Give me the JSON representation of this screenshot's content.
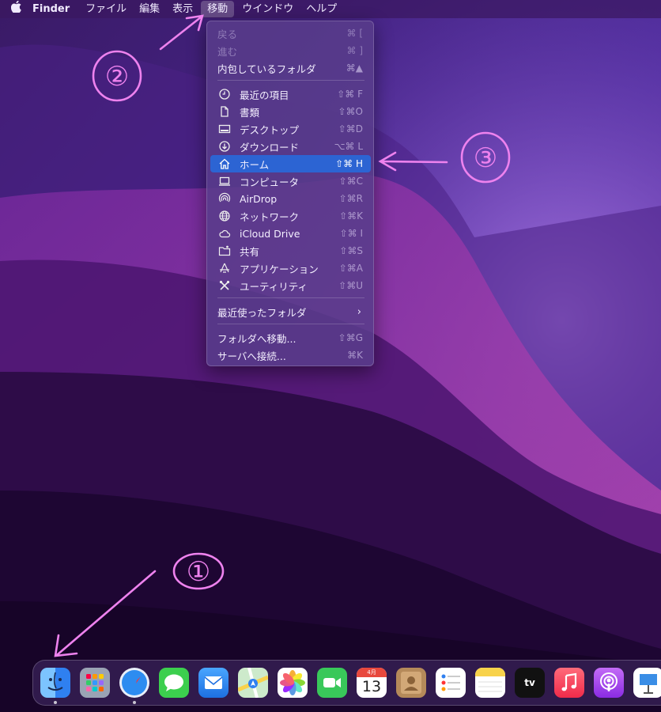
{
  "menubar": {
    "apple_icon": "apple-icon",
    "app_name": "Finder",
    "items": [
      "ファイル",
      "編集",
      "表示",
      "移動",
      "ウインドウ",
      "ヘルプ"
    ],
    "active_item": "移動"
  },
  "go_menu": {
    "top_items": [
      {
        "label": "戻る",
        "shortcut": "⌘ [",
        "enabled": false
      },
      {
        "label": "進む",
        "shortcut": "⌘ ]",
        "enabled": false
      },
      {
        "label": "内包しているフォルダ",
        "shortcut": "⌘▲",
        "enabled": true
      }
    ],
    "places": [
      {
        "label": "最近の項目",
        "shortcut": "⇧⌘ F",
        "icon": "clock-icon"
      },
      {
        "label": "書類",
        "shortcut": "⇧⌘O",
        "icon": "document-icon"
      },
      {
        "label": "デスクトップ",
        "shortcut": "⇧⌘D",
        "icon": "desktop-icon"
      },
      {
        "label": "ダウンロード",
        "shortcut": "⌥⌘ L",
        "icon": "download-icon"
      },
      {
        "label": "ホーム",
        "shortcut": "⇧⌘ H",
        "icon": "home-icon",
        "highlighted": true
      },
      {
        "label": "コンピュータ",
        "shortcut": "⇧⌘C",
        "icon": "laptop-icon"
      },
      {
        "label": "AirDrop",
        "shortcut": "⇧⌘R",
        "icon": "airdrop-icon"
      },
      {
        "label": "ネットワーク",
        "shortcut": "⇧⌘K",
        "icon": "network-globe-icon"
      },
      {
        "label": "iCloud Drive",
        "shortcut": "⇧⌘ I",
        "icon": "cloud-icon"
      },
      {
        "label": "共有",
        "shortcut": "⇧⌘S",
        "icon": "shared-folder-icon"
      },
      {
        "label": "アプリケーション",
        "shortcut": "⇧⌘A",
        "icon": "applications-icon"
      },
      {
        "label": "ユーティリティ",
        "shortcut": "⇧⌘U",
        "icon": "utilities-tools-icon"
      }
    ],
    "recent_folders": {
      "label": "最近使ったフォルダ",
      "icon": "chevron-right-icon"
    },
    "bottom_items": [
      {
        "label": "フォルダへ移動...",
        "shortcut": "⇧⌘G"
      },
      {
        "label": "サーバへ接続...",
        "shortcut": "⌘K"
      }
    ]
  },
  "annotations": {
    "color": "#ee82ee",
    "marks": [
      "①",
      "②",
      "③"
    ]
  },
  "dock": {
    "apps": [
      {
        "name": "finder-icon",
        "running": true
      },
      {
        "name": "launchpad-icon",
        "running": false
      },
      {
        "name": "safari-icon",
        "running": true
      },
      {
        "name": "messages-icon",
        "running": false
      },
      {
        "name": "mail-icon",
        "running": false
      },
      {
        "name": "maps-icon",
        "running": false
      },
      {
        "name": "photos-icon",
        "running": false
      },
      {
        "name": "facetime-icon",
        "running": false
      },
      {
        "name": "calendar-icon",
        "running": false
      },
      {
        "name": "contacts-icon",
        "running": false
      },
      {
        "name": "reminders-icon",
        "running": false
      },
      {
        "name": "notes-icon",
        "running": false
      },
      {
        "name": "apple-tv-icon",
        "running": false
      },
      {
        "name": "music-icon",
        "running": false
      },
      {
        "name": "podcasts-icon",
        "running": false
      },
      {
        "name": "keynote-icon",
        "running": false
      }
    ],
    "calendar": {
      "month": "4月",
      "day": "13"
    },
    "tv_label": "tv"
  },
  "colors": {
    "menu_highlight": "#2c64d3",
    "wallpaper_base": "#2a0f4a",
    "annotation_pink": "#ee82ee"
  }
}
